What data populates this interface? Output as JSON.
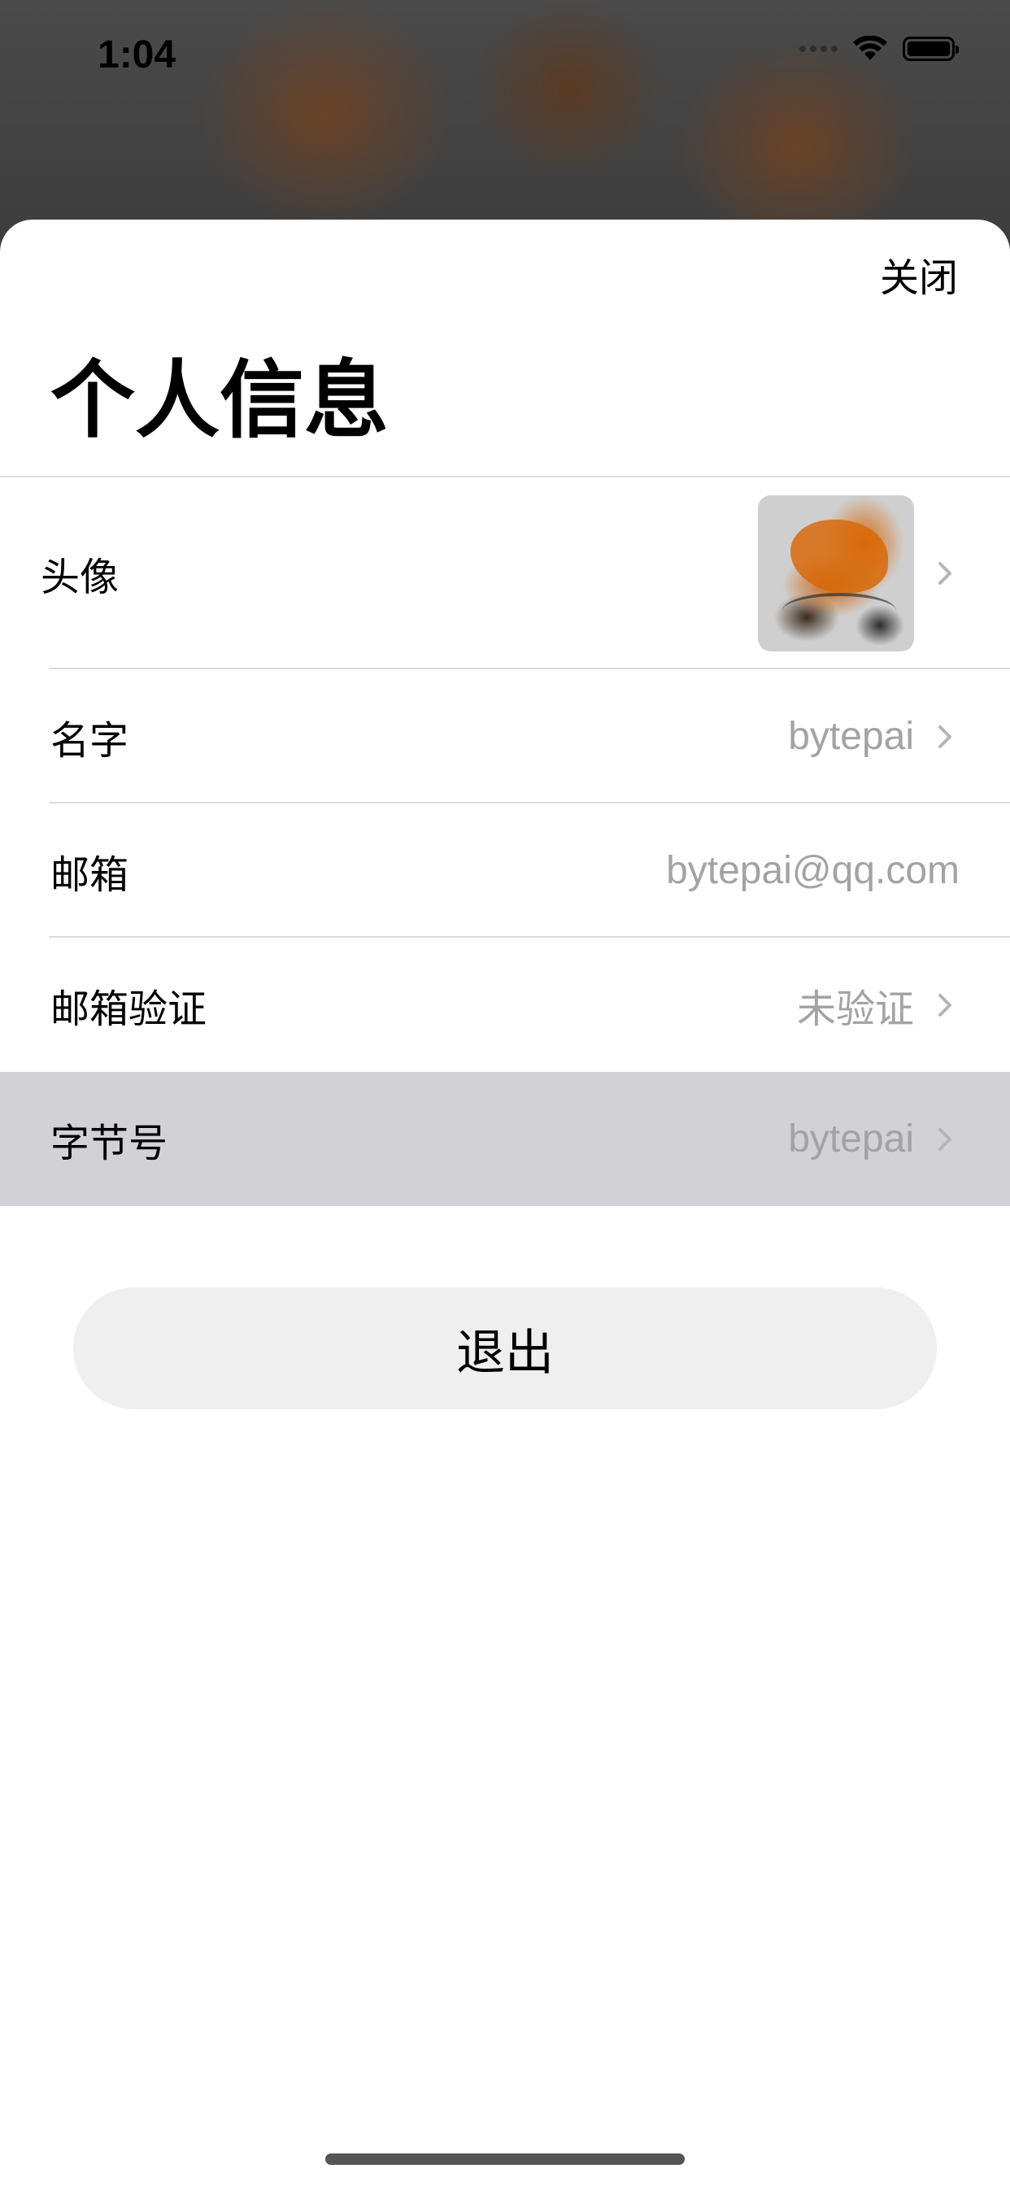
{
  "status_bar": {
    "time": "1:04"
  },
  "sheet": {
    "close_label": "关闭",
    "title": "个人信息"
  },
  "rows": [
    {
      "label": "头像",
      "value": "",
      "has_chevron": true
    },
    {
      "label": "名字",
      "value": "bytepai",
      "has_chevron": true
    },
    {
      "label": "邮箱",
      "value": "bytepai@qq.com",
      "has_chevron": false
    },
    {
      "label": "邮箱验证",
      "value": "未验证",
      "has_chevron": true
    },
    {
      "label": "字节号",
      "value": "bytepai",
      "has_chevron": true,
      "highlighted": true
    }
  ],
  "logout_label": "退出",
  "colors": {
    "value_text": "#a3a3a3",
    "highlight_row": "#d1d1d6",
    "logout_bg": "#efefef"
  },
  "icons": [
    "wifi-icon",
    "battery-icon",
    "signal-icon",
    "chevron-right-icon"
  ]
}
